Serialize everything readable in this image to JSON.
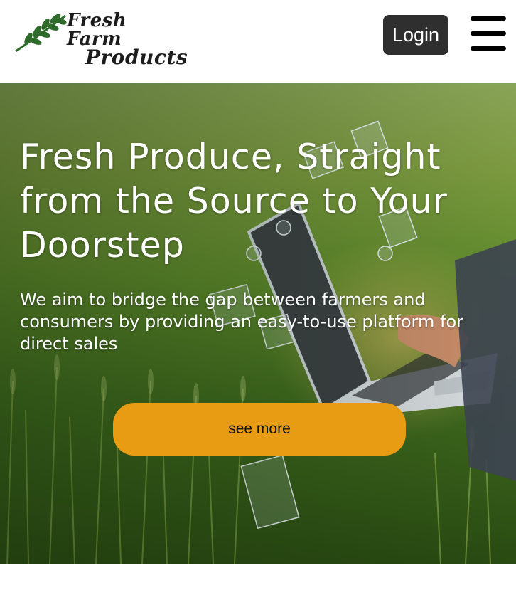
{
  "header": {
    "logo": {
      "line1": "Fresh Farm",
      "line2": "Products",
      "icon": "wheat-leaf-icon"
    },
    "login_label": "Login",
    "menu_icon": "hamburger-menu-icon"
  },
  "hero": {
    "title": "Fresh Produce, Straight from the Source to Your Doorstep",
    "text": "We aim to bridge the gap between farmers and consumers by providing an easy-to-use platform for direct sales",
    "button_label": "see more"
  },
  "colors": {
    "accent": "#e89c14",
    "login_bg": "#2f2f2f",
    "logo_leaf": "#2e6b2a"
  }
}
